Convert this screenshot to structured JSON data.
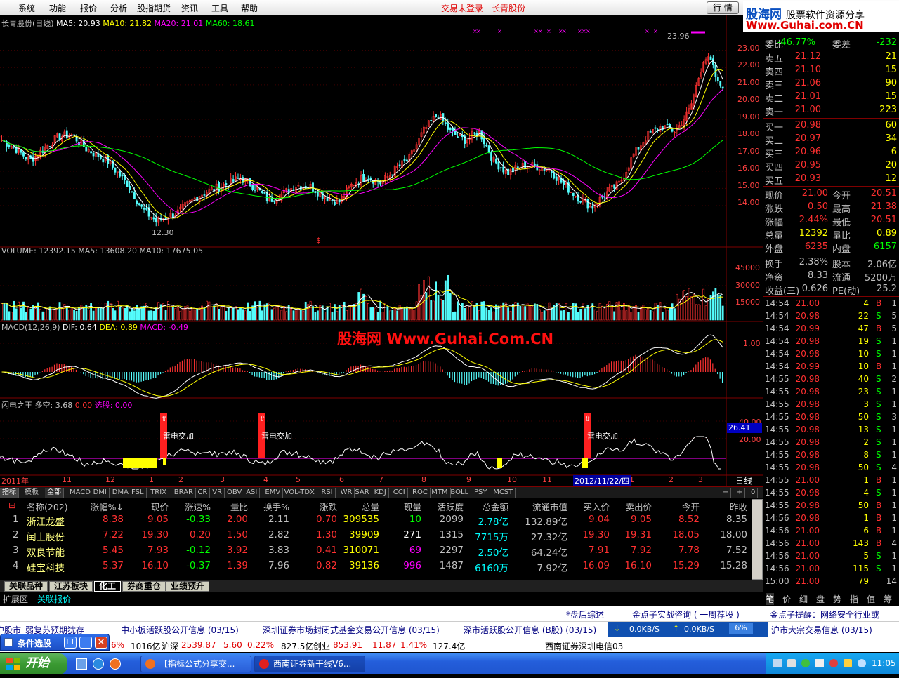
{
  "menubar": {
    "items": [
      "系统",
      "功能",
      "报价",
      "分析",
      "股指期货",
      "资讯",
      "工具",
      "帮助"
    ],
    "trade_status": "交易未登录",
    "stock_name": "长青股份",
    "quote_button": "行 情"
  },
  "logo": {
    "brand": "股海网",
    "tagline": "股票软件资源分享",
    "url": "Www.Guhai.com.CN"
  },
  "watermark": "股海网 Www.Guhai.Com.CN",
  "kline": {
    "title": "长青股份(日线)",
    "ma": [
      {
        "label": "MA5: 20.93",
        "color": "#ffffff"
      },
      {
        "label": "MA10: 21.82",
        "color": "#ffff00"
      },
      {
        "label": "MA20: 21.01",
        "color": "#ff00ff"
      },
      {
        "label": "MA60: 18.61",
        "color": "#00ff00"
      }
    ],
    "y_ticks": [
      "23.00",
      "22.00",
      "21.00",
      "20.00",
      "19.00",
      "18.00",
      "17.00",
      "16.00",
      "15.00",
      "14.00"
    ],
    "high_label": "23.96",
    "low_label": "12.30",
    "marker": "$"
  },
  "volume": {
    "label": "VOLUME: 12392.15  MA5: 13608.20  MA10: 17675.05",
    "y_ticks": [
      "45000",
      "30000",
      "15000"
    ]
  },
  "macd": {
    "title": "MACD(12,26,9)",
    "dif": "DIF: 0.64",
    "dea": "DEA: 0.89",
    "macd": "MACD: -0.49",
    "y_ticks": [
      "1.00"
    ]
  },
  "lightning": {
    "title": "闪电之王",
    "duokong": "多空: 3.68",
    "v2": "0.00",
    "xuangu": "选股: 0.00",
    "signal_label": "雷电交加",
    "y_ticks": [
      "40.00",
      "20.00"
    ],
    "current": "26.41"
  },
  "xaxis": {
    "year": "2011年",
    "months": [
      "11",
      "12",
      "1",
      "2",
      "3",
      "4",
      "5",
      "6",
      "7",
      "8",
      "9",
      "10",
      "11",
      "1",
      "2",
      "3"
    ],
    "cursor_date": "2012/11/22/四",
    "period": "日线"
  },
  "indicator_tabs": [
    "指标",
    "模板",
    "全部",
    "MACD",
    "DMI",
    "DMA",
    "FSL",
    "TRIX",
    "BRAR",
    "CR",
    "VR",
    "OBV",
    "ASI",
    "EMV",
    "VOL-TDX",
    "RSI",
    "WR",
    "SAR",
    "KDJ",
    "CCI",
    "ROC",
    "MTM",
    "BOLL",
    "PSY",
    "MCST"
  ],
  "stock_table": {
    "headers": [
      "名称(202)",
      "涨幅%↓",
      "现价",
      "涨速%",
      "量比",
      "换手%",
      "涨跌",
      "总量",
      "现量",
      "活跃度",
      "总金额",
      "流通市值",
      "买入价",
      "卖出价",
      "今开",
      "昨收"
    ],
    "rows": [
      {
        "no": "1",
        "name": "浙江龙盛",
        "chg": "8.38",
        "price": "9.05",
        "speed": "-0.33",
        "vr": "2.00",
        "turn": "2.11",
        "diff": "0.70",
        "vol": "309535",
        "cur": "10",
        "act": "2099",
        "amt": "2.78亿",
        "mcap": "132.89亿",
        "bid": "9.04",
        "ask": "9.05",
        "open": "8.52",
        "prev": "8.35"
      },
      {
        "no": "2",
        "name": "闰土股份",
        "chg": "7.22",
        "price": "19.30",
        "speed": "0.20",
        "vr": "1.50",
        "turn": "2.82",
        "diff": "1.30",
        "vol": "39909",
        "cur": "271",
        "act": "1315",
        "amt": "7715万",
        "mcap": "27.32亿",
        "bid": "19.30",
        "ask": "19.31",
        "open": "18.05",
        "prev": "18.00"
      },
      {
        "no": "3",
        "name": "双良节能",
        "chg": "5.45",
        "price": "7.93",
        "speed": "-0.12",
        "vr": "3.92",
        "turn": "3.83",
        "diff": "0.41",
        "vol": "310071",
        "cur": "69",
        "act": "2297",
        "amt": "2.50亿",
        "mcap": "64.24亿",
        "bid": "7.91",
        "ask": "7.92",
        "open": "7.78",
        "prev": "7.52"
      },
      {
        "no": "4",
        "name": "硅宝科技",
        "chg": "5.37",
        "price": "16.10",
        "speed": "-0.37",
        "vr": "1.39",
        "turn": "7.96",
        "diff": "0.82",
        "vol": "39136",
        "cur": "996",
        "act": "1487",
        "amt": "6160万",
        "mcap": "7.92亿",
        "bid": "16.09",
        "ask": "16.10",
        "open": "15.29",
        "prev": "15.28"
      }
    ]
  },
  "bottom_tabs": [
    "关联品种",
    "江苏板块",
    "化工",
    "券商重仓",
    "业绩预升"
  ],
  "ext": {
    "ext_area": "扩展区",
    "related": "关联报价"
  },
  "order_book": {
    "weibi_label": "委比",
    "weibi": "-46.77%",
    "weicha_label": "委差",
    "weicha": "-232",
    "sell": [
      {
        "label": "卖五",
        "price": "21.12",
        "vol": "21"
      },
      {
        "label": "卖四",
        "price": "21.10",
        "vol": "15"
      },
      {
        "label": "卖三",
        "price": "21.06",
        "vol": "90"
      },
      {
        "label": "卖二",
        "price": "21.01",
        "vol": "15"
      },
      {
        "label": "卖一",
        "price": "21.00",
        "vol": "223"
      }
    ],
    "buy": [
      {
        "label": "买一",
        "price": "20.98",
        "vol": "60"
      },
      {
        "label": "买二",
        "price": "20.97",
        "vol": "34"
      },
      {
        "label": "买三",
        "price": "20.96",
        "vol": "6"
      },
      {
        "label": "买四",
        "price": "20.95",
        "vol": "20"
      },
      {
        "label": "买五",
        "price": "20.93",
        "vol": "12"
      }
    ]
  },
  "stats": [
    {
      "l1": "现价",
      "v1": "21.00",
      "l2": "今开",
      "v2": "20.51"
    },
    {
      "l1": "涨跌",
      "v1": "0.50",
      "l2": "最高",
      "v2": "21.38"
    },
    {
      "l1": "涨幅",
      "v1": "2.44%",
      "l2": "最低",
      "v2": "20.51"
    },
    {
      "l1": "总量",
      "v1": "12392",
      "l2": "量比",
      "v2": "0.89"
    },
    {
      "l1": "外盘",
      "v1": "6235",
      "l2": "内盘",
      "v2": "6157"
    },
    {
      "l1": "换手",
      "v1": "2.38%",
      "l2": "股本",
      "v2": "2.06亿"
    },
    {
      "l1": "净资",
      "v1": "8.33",
      "l2": "流通",
      "v2": "5200万"
    },
    {
      "l1": "收益(三)",
      "v1": "0.626",
      "l2": "PE(动)",
      "v2": "25.2"
    }
  ],
  "ticks": [
    {
      "t": "14:54",
      "p": "21.00",
      "v": "4",
      "s": "B",
      "n": "1"
    },
    {
      "t": "14:54",
      "p": "20.98",
      "v": "22",
      "s": "S",
      "n": "5"
    },
    {
      "t": "14:54",
      "p": "20.99",
      "v": "47",
      "s": "B",
      "n": "5"
    },
    {
      "t": "14:54",
      "p": "20.98",
      "v": "19",
      "s": "S",
      "n": "1"
    },
    {
      "t": "14:54",
      "p": "20.98",
      "v": "10",
      "s": "S",
      "n": "1"
    },
    {
      "t": "14:54",
      "p": "20.99",
      "v": "10",
      "s": "B",
      "n": "1"
    },
    {
      "t": "14:55",
      "p": "20.98",
      "v": "40",
      "s": "S",
      "n": "2"
    },
    {
      "t": "14:55",
      "p": "20.98",
      "v": "23",
      "s": "S",
      "n": "1"
    },
    {
      "t": "14:55",
      "p": "20.98",
      "v": "3",
      "s": "S",
      "n": "1"
    },
    {
      "t": "14:55",
      "p": "20.98",
      "v": "50",
      "s": "S",
      "n": "3"
    },
    {
      "t": "14:55",
      "p": "20.98",
      "v": "13",
      "s": "S",
      "n": "1"
    },
    {
      "t": "14:55",
      "p": "20.98",
      "v": "2",
      "s": "S",
      "n": "1"
    },
    {
      "t": "14:55",
      "p": "20.98",
      "v": "8",
      "s": "S",
      "n": "1"
    },
    {
      "t": "14:55",
      "p": "20.98",
      "v": "50",
      "s": "S",
      "n": "4"
    },
    {
      "t": "14:55",
      "p": "21.00",
      "v": "1",
      "s": "B",
      "n": "1"
    },
    {
      "t": "14:55",
      "p": "20.98",
      "v": "4",
      "s": "S",
      "n": "1"
    },
    {
      "t": "14:55",
      "p": "20.98",
      "v": "50",
      "s": "B",
      "n": "1"
    },
    {
      "t": "14:56",
      "p": "20.98",
      "v": "1",
      "s": "B",
      "n": "1"
    },
    {
      "t": "14:56",
      "p": "21.00",
      "v": "6",
      "s": "B",
      "n": "1"
    },
    {
      "t": "14:56",
      "p": "21.00",
      "v": "143",
      "s": "B",
      "n": "4"
    },
    {
      "t": "14:56",
      "p": "21.00",
      "v": "5",
      "s": "S",
      "n": "1"
    },
    {
      "t": "14:56",
      "p": "21.00",
      "v": "115",
      "s": "S",
      "n": "1"
    },
    {
      "t": "15:00",
      "p": "21.00",
      "v": "79",
      "s": "",
      "n": "14"
    }
  ],
  "right_tabs": [
    "笔",
    "价",
    "细",
    "盘",
    "势",
    "指",
    "值",
    "筹"
  ],
  "news1": [
    "*盘后综述",
    "金点子实战咨询 ( 一周荐股 )",
    "金点子提醒：网络安全行业或"
  ],
  "news2": [
    "沪股市_弱复苏预期犹存",
    "中小板活跃股公开信息 (03/15)",
    "深圳证券市场封闭式基金交易公开信息 (03/15)",
    "深市活跃股公开信息 (B股) (03/15)",
    "沪市大宗交易信息 (03/15)"
  ],
  "netspeed": {
    "down": "0.0KB/S",
    "up": "0.0KB/S",
    "pct": "6%"
  },
  "indexbar": {
    "prefix_chg": "6%",
    "prefix_amt": "1016亿",
    "hs_label": "沪深",
    "hs_val": "2539.87",
    "hs_chg": "5.60",
    "hs_pct": "0.22%",
    "hs_amt": "827.5亿",
    "cy_label": "创业",
    "cy_val": "853.91",
    "cy_chg": "11.87",
    "cy_pct": "1.41%",
    "cy_amt": "127.4亿",
    "broker": "西南证券深圳电信03"
  },
  "floatwin": {
    "title": "条件选股"
  },
  "taskbar": {
    "start": "开始",
    "task1": "【指标公式分享交...",
    "task2": "西南证券新干线V6...",
    "clock": "11:05"
  }
}
